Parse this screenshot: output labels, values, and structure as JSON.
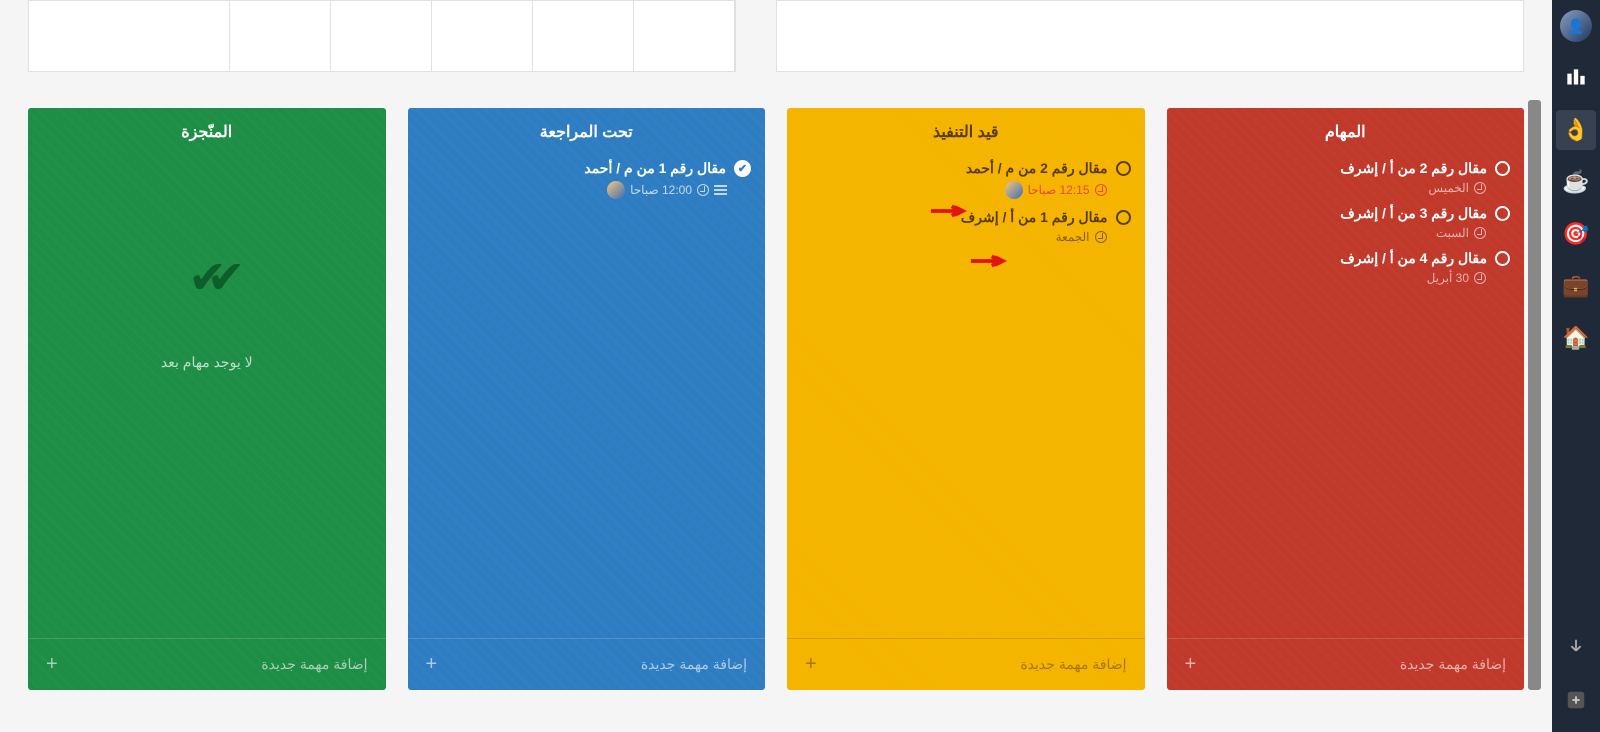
{
  "sidebar": {
    "items": [
      "avatar",
      "logo",
      "ok",
      "coffee",
      "target",
      "briefcase",
      "home"
    ],
    "bottom": [
      "download",
      "add"
    ]
  },
  "columns": {
    "tasks": {
      "title": "المهام",
      "items": [
        {
          "title": "مقال رقم 2 من أ / إشرف",
          "meta": "الخميس"
        },
        {
          "title": "مقال رقم 3 من أ / إشرف",
          "meta": "السبت"
        },
        {
          "title": "مقال رقم 4 من أ / إشرف",
          "meta": "30 أبريل"
        }
      ],
      "add": "إضافة مهمة جديدة"
    },
    "inprogress": {
      "title": "قيد التنفيذ",
      "items": [
        {
          "title": "مقال رقم 2 من م / أحمد",
          "meta": "12:15 صباحا",
          "overdue": true,
          "avatar": true
        },
        {
          "title": "مقال رقم 1 من أ / إشرف",
          "meta": "الجمعة"
        }
      ],
      "add": "إضافة مهمة جديدة"
    },
    "review": {
      "title": "تحت المراجعة",
      "items": [
        {
          "title": "مقال رقم 1 من م / أحمد",
          "meta": "12:00 صباحا",
          "avatar": true,
          "list": true,
          "done": true
        }
      ],
      "add": "إضافة مهمة جديدة"
    },
    "done": {
      "title": "المنّجزة",
      "empty": "لا يوجد مهام بعد",
      "add": "إضافة مهمة جديدة"
    }
  }
}
